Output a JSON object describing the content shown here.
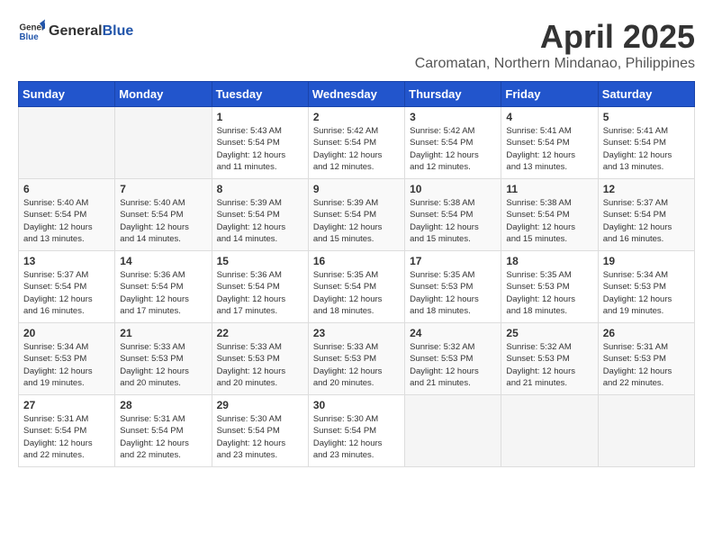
{
  "header": {
    "logo_general": "General",
    "logo_blue": "Blue",
    "month_title": "April 2025",
    "location": "Caromatan, Northern Mindanao, Philippines"
  },
  "days_of_week": [
    "Sunday",
    "Monday",
    "Tuesday",
    "Wednesday",
    "Thursday",
    "Friday",
    "Saturday"
  ],
  "weeks": [
    [
      {
        "day": "",
        "info": ""
      },
      {
        "day": "",
        "info": ""
      },
      {
        "day": "1",
        "info": "Sunrise: 5:43 AM\nSunset: 5:54 PM\nDaylight: 12 hours\nand 11 minutes."
      },
      {
        "day": "2",
        "info": "Sunrise: 5:42 AM\nSunset: 5:54 PM\nDaylight: 12 hours\nand 12 minutes."
      },
      {
        "day": "3",
        "info": "Sunrise: 5:42 AM\nSunset: 5:54 PM\nDaylight: 12 hours\nand 12 minutes."
      },
      {
        "day": "4",
        "info": "Sunrise: 5:41 AM\nSunset: 5:54 PM\nDaylight: 12 hours\nand 13 minutes."
      },
      {
        "day": "5",
        "info": "Sunrise: 5:41 AM\nSunset: 5:54 PM\nDaylight: 12 hours\nand 13 minutes."
      }
    ],
    [
      {
        "day": "6",
        "info": "Sunrise: 5:40 AM\nSunset: 5:54 PM\nDaylight: 12 hours\nand 13 minutes."
      },
      {
        "day": "7",
        "info": "Sunrise: 5:40 AM\nSunset: 5:54 PM\nDaylight: 12 hours\nand 14 minutes."
      },
      {
        "day": "8",
        "info": "Sunrise: 5:39 AM\nSunset: 5:54 PM\nDaylight: 12 hours\nand 14 minutes."
      },
      {
        "day": "9",
        "info": "Sunrise: 5:39 AM\nSunset: 5:54 PM\nDaylight: 12 hours\nand 15 minutes."
      },
      {
        "day": "10",
        "info": "Sunrise: 5:38 AM\nSunset: 5:54 PM\nDaylight: 12 hours\nand 15 minutes."
      },
      {
        "day": "11",
        "info": "Sunrise: 5:38 AM\nSunset: 5:54 PM\nDaylight: 12 hours\nand 15 minutes."
      },
      {
        "day": "12",
        "info": "Sunrise: 5:37 AM\nSunset: 5:54 PM\nDaylight: 12 hours\nand 16 minutes."
      }
    ],
    [
      {
        "day": "13",
        "info": "Sunrise: 5:37 AM\nSunset: 5:54 PM\nDaylight: 12 hours\nand 16 minutes."
      },
      {
        "day": "14",
        "info": "Sunrise: 5:36 AM\nSunset: 5:54 PM\nDaylight: 12 hours\nand 17 minutes."
      },
      {
        "day": "15",
        "info": "Sunrise: 5:36 AM\nSunset: 5:54 PM\nDaylight: 12 hours\nand 17 minutes."
      },
      {
        "day": "16",
        "info": "Sunrise: 5:35 AM\nSunset: 5:54 PM\nDaylight: 12 hours\nand 18 minutes."
      },
      {
        "day": "17",
        "info": "Sunrise: 5:35 AM\nSunset: 5:53 PM\nDaylight: 12 hours\nand 18 minutes."
      },
      {
        "day": "18",
        "info": "Sunrise: 5:35 AM\nSunset: 5:53 PM\nDaylight: 12 hours\nand 18 minutes."
      },
      {
        "day": "19",
        "info": "Sunrise: 5:34 AM\nSunset: 5:53 PM\nDaylight: 12 hours\nand 19 minutes."
      }
    ],
    [
      {
        "day": "20",
        "info": "Sunrise: 5:34 AM\nSunset: 5:53 PM\nDaylight: 12 hours\nand 19 minutes."
      },
      {
        "day": "21",
        "info": "Sunrise: 5:33 AM\nSunset: 5:53 PM\nDaylight: 12 hours\nand 20 minutes."
      },
      {
        "day": "22",
        "info": "Sunrise: 5:33 AM\nSunset: 5:53 PM\nDaylight: 12 hours\nand 20 minutes."
      },
      {
        "day": "23",
        "info": "Sunrise: 5:33 AM\nSunset: 5:53 PM\nDaylight: 12 hours\nand 20 minutes."
      },
      {
        "day": "24",
        "info": "Sunrise: 5:32 AM\nSunset: 5:53 PM\nDaylight: 12 hours\nand 21 minutes."
      },
      {
        "day": "25",
        "info": "Sunrise: 5:32 AM\nSunset: 5:53 PM\nDaylight: 12 hours\nand 21 minutes."
      },
      {
        "day": "26",
        "info": "Sunrise: 5:31 AM\nSunset: 5:53 PM\nDaylight: 12 hours\nand 22 minutes."
      }
    ],
    [
      {
        "day": "27",
        "info": "Sunrise: 5:31 AM\nSunset: 5:54 PM\nDaylight: 12 hours\nand 22 minutes."
      },
      {
        "day": "28",
        "info": "Sunrise: 5:31 AM\nSunset: 5:54 PM\nDaylight: 12 hours\nand 22 minutes."
      },
      {
        "day": "29",
        "info": "Sunrise: 5:30 AM\nSunset: 5:54 PM\nDaylight: 12 hours\nand 23 minutes."
      },
      {
        "day": "30",
        "info": "Sunrise: 5:30 AM\nSunset: 5:54 PM\nDaylight: 12 hours\nand 23 minutes."
      },
      {
        "day": "",
        "info": ""
      },
      {
        "day": "",
        "info": ""
      },
      {
        "day": "",
        "info": ""
      }
    ]
  ]
}
